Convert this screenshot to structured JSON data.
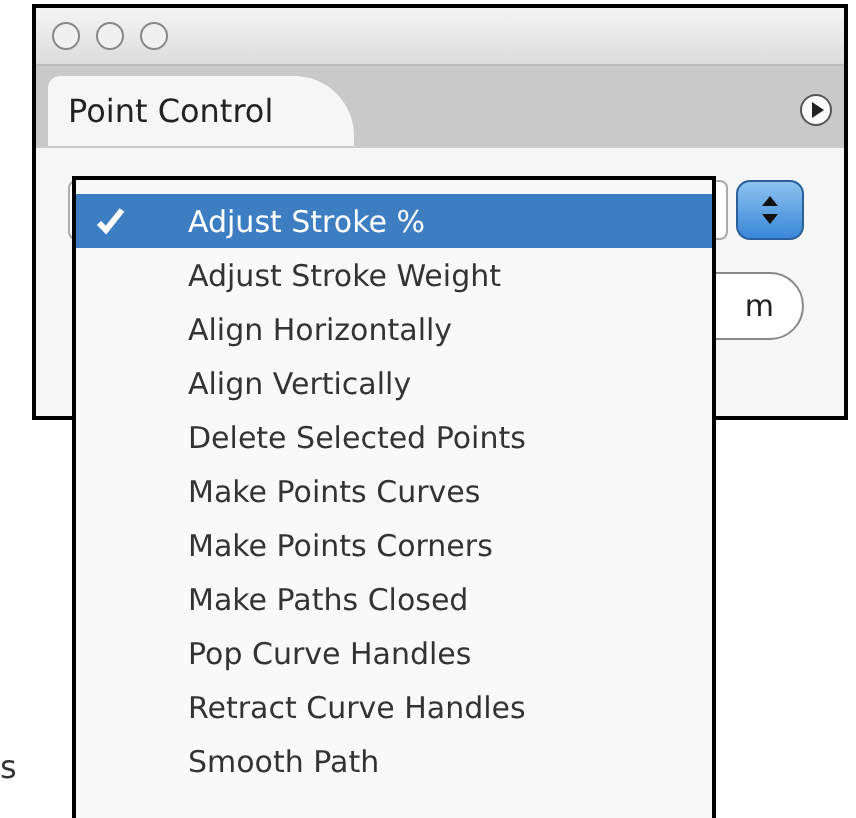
{
  "tabs": [
    {
      "label": "Point Control",
      "selected": true
    }
  ],
  "background_button": {
    "label": "m"
  },
  "popup_menu": {
    "items": [
      {
        "label": "Adjust Stroke  %",
        "selected": true
      },
      {
        "label": "Adjust Stroke Weight",
        "selected": false
      },
      {
        "label": "Align Horizontally",
        "selected": false
      },
      {
        "label": "Align Vertically",
        "selected": false
      },
      {
        "label": "Delete Selected Points",
        "selected": false
      },
      {
        "label": "Make Points Curves",
        "selected": false
      },
      {
        "label": "Make Points Corners",
        "selected": false
      },
      {
        "label": "Make Paths Closed",
        "selected": false
      },
      {
        "label": "Pop Curve Handles",
        "selected": false
      },
      {
        "label": "Retract Curve Handles",
        "selected": false
      },
      {
        "label": "Smooth Path",
        "selected": false
      }
    ]
  },
  "margin_text": "s"
}
